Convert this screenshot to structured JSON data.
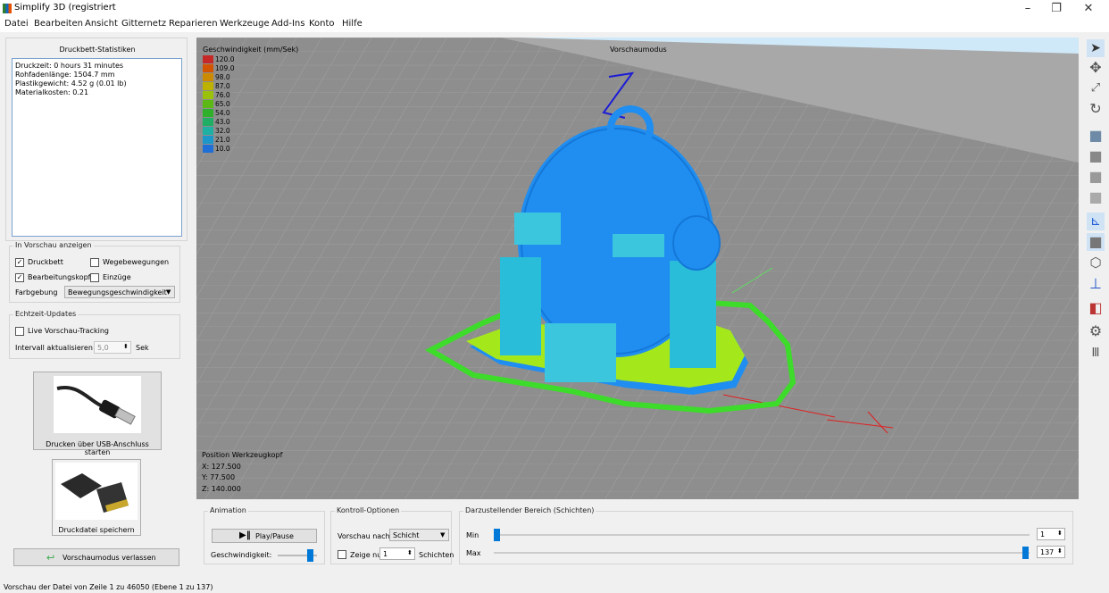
{
  "window": {
    "title": "Simplify 3D (registriert",
    "minimize": "–",
    "maximize": "❐",
    "close": "✕"
  },
  "menu": [
    "Datei",
    "Bearbeiten",
    "Ansicht",
    "Gitternetz",
    "Reparieren",
    "Werkzeuge",
    "Add-Ins",
    "Konto",
    "Hilfe"
  ],
  "stats": {
    "title": "Druckbett-Statistiken",
    "lines": [
      "Druckzeit: 0 hours 31 minutes",
      "Rohfadenlänge: 1504.7 mm",
      "Plastikgewicht: 4.52 g (0.01 lb)",
      "Materialkosten: 0.21"
    ]
  },
  "preview": {
    "title": "In Vorschau anzeigen",
    "druckbett": "Druckbett",
    "wegebewegungen": "Wegebewegungen",
    "bearbeitungskopf": "Bearbeitungskopf",
    "einzuege": "Einzüge",
    "farbgebung_label": "Farbgebung",
    "farbgebung_value": "Bewegungsgeschwindigkeit",
    "druckbett_checked": true,
    "wegebewegungen_checked": false,
    "bearbeitungskopf_checked": true,
    "einzuege_checked": false
  },
  "realtime": {
    "title": "Echtzeit-Updates",
    "live_label": "Live Vorschau-Tracking",
    "live_checked": false,
    "interval_label": "Intervall aktualisieren",
    "interval_value": "5,0",
    "interval_unit": "Sek"
  },
  "buttons": {
    "usb": "Drucken über USB-Anschluss starten",
    "save": "Druckdatei speichern",
    "exit": "Vorschaumodus verlassen"
  },
  "viewport": {
    "mode": "Vorschaumodus",
    "legend_title": "Geschwindigkeit (mm/Sek)",
    "legend": [
      {
        "value": "120.0",
        "color": "#c62828"
      },
      {
        "value": "109.0",
        "color": "#d35400"
      },
      {
        "value": "98.0",
        "color": "#cc8a00"
      },
      {
        "value": "87.0",
        "color": "#bdb200"
      },
      {
        "value": "76.0",
        "color": "#9ac20a"
      },
      {
        "value": "65.0",
        "color": "#5cb814"
      },
      {
        "value": "54.0",
        "color": "#2eb02a"
      },
      {
        "value": "43.0",
        "color": "#1fae63"
      },
      {
        "value": "32.0",
        "color": "#1fb0a4"
      },
      {
        "value": "21.0",
        "color": "#1c97c9"
      },
      {
        "value": "10.0",
        "color": "#1f6fd6"
      }
    ],
    "position_title": "Position Werkzeugkopf",
    "pos_x": "X: 127.500",
    "pos_y": "Y: 77.500",
    "pos_z": "Z: 140.000"
  },
  "animation": {
    "title": "Animation",
    "play": "Play/Pause",
    "speed_label": "Geschwindigkeit:",
    "speed_level": 0.9
  },
  "control": {
    "title": "Kontroll-Optionen",
    "preview_by_label": "Vorschau nach",
    "preview_by_value": "Schicht",
    "show_only_label": "Zeige nur",
    "show_only_value": "1",
    "layers_label": "Schichten"
  },
  "range": {
    "title": "Darzustellender Bereich (Schichten)",
    "min_label": "Min",
    "max_label": "Max",
    "min_value": "1",
    "max_value": "137"
  },
  "status": "Vorschau der Datei von Zeile 1 zu 46050 (Ebene 1 zu 137)",
  "colors": {
    "accent": "#0078d7",
    "model_blue": "#1f8ef0",
    "raft_green": "#a4e81c",
    "skirt_green": "#3ddc2a"
  }
}
